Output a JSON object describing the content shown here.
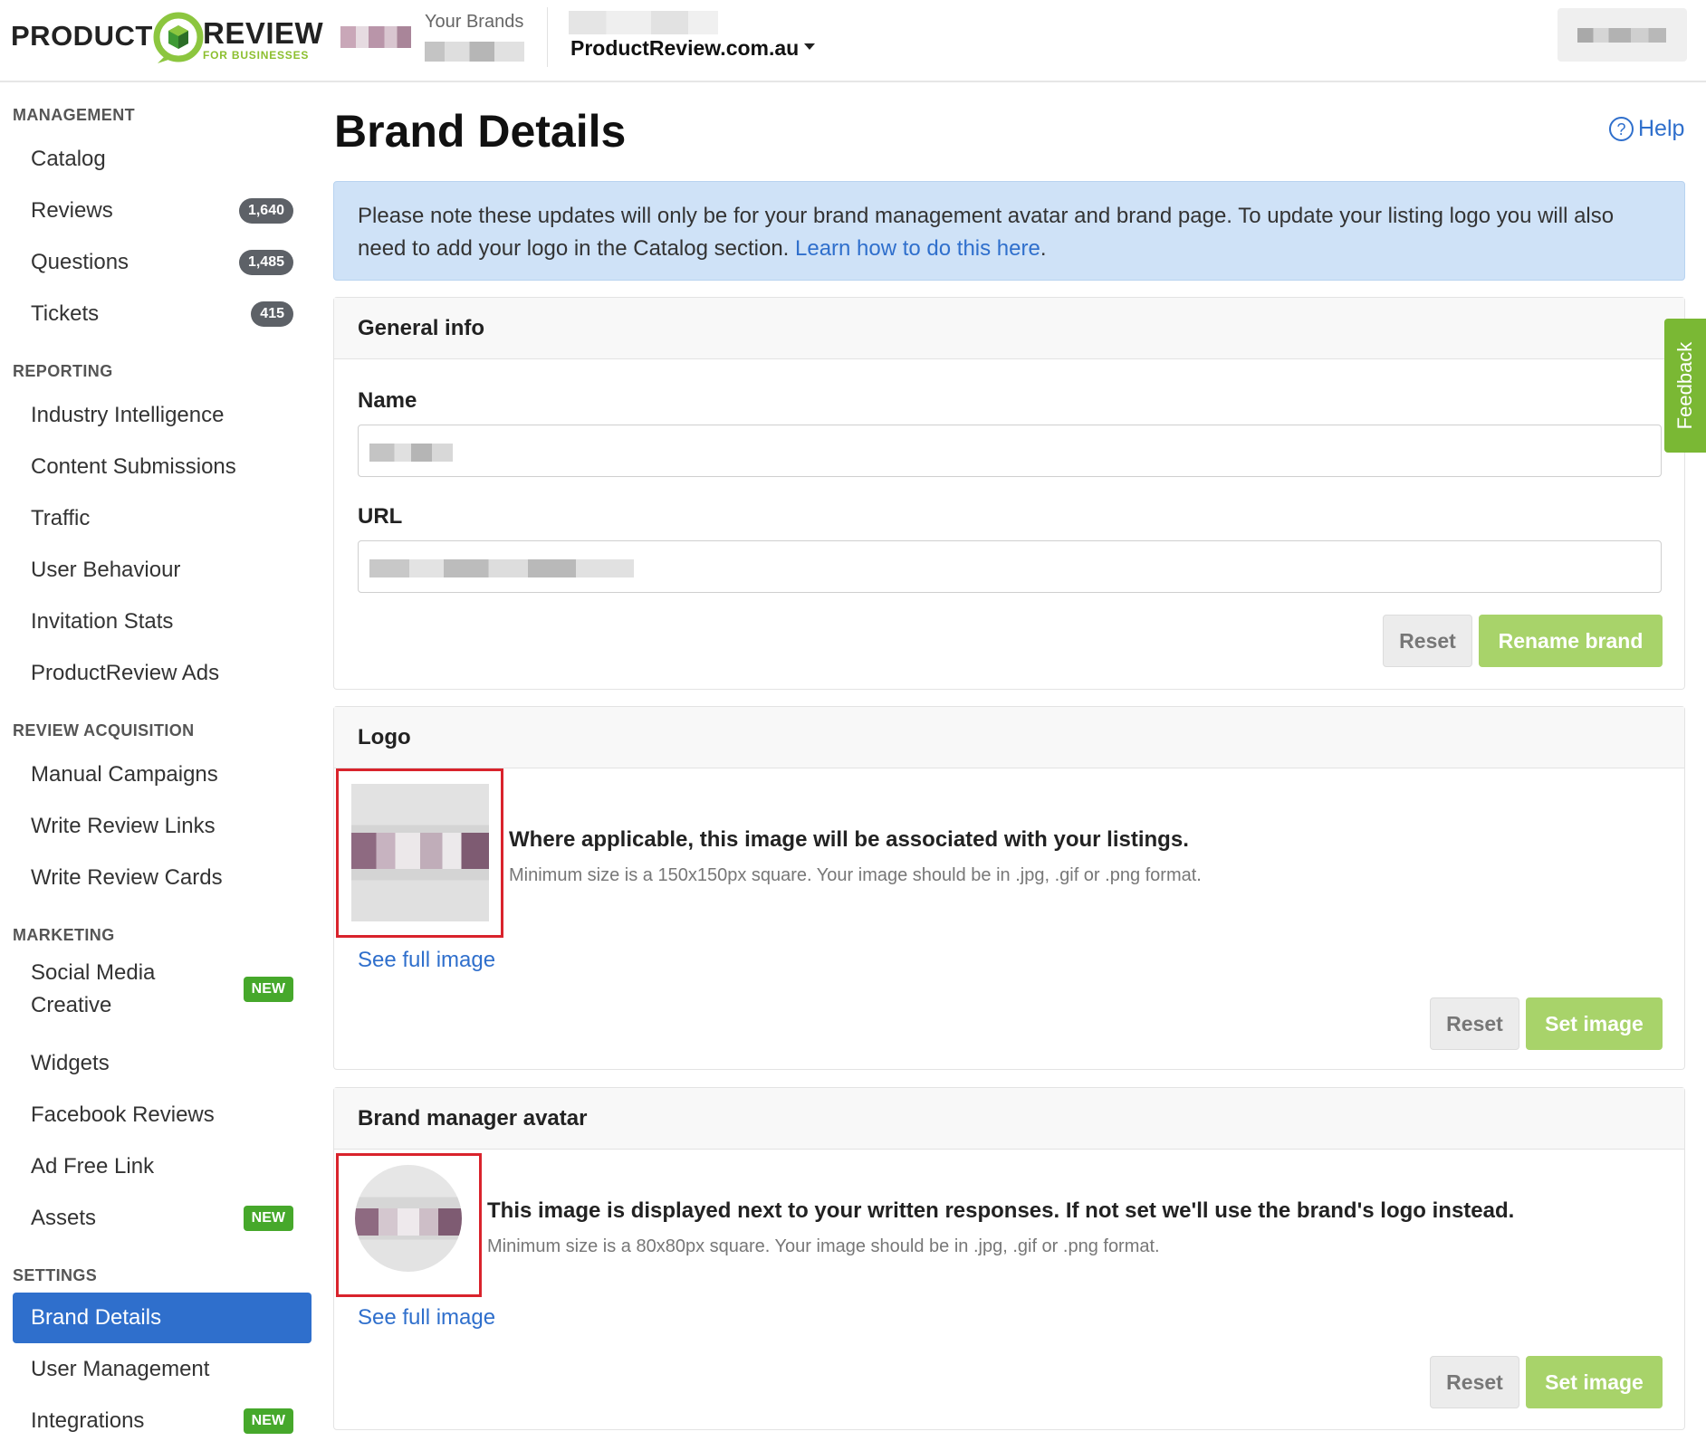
{
  "header": {
    "logo_left": "PRODUCT",
    "logo_right": "REVIEW",
    "logo_sub": "FOR BUSINESSES",
    "your_brands_label": "Your Brands",
    "account_site": "ProductReview.com.au"
  },
  "sidebar": {
    "sections": {
      "management": "MANAGEMENT",
      "reporting": "REPORTING",
      "review_acquisition": "REVIEW ACQUISITION",
      "marketing": "MARKETING",
      "settings": "SETTINGS"
    },
    "items": {
      "catalog": "Catalog",
      "reviews": "Reviews",
      "reviews_badge": "1,640",
      "questions": "Questions",
      "questions_badge": "1,485",
      "tickets": "Tickets",
      "tickets_badge": "415",
      "industry_intelligence": "Industry Intelligence",
      "content_submissions": "Content Submissions",
      "traffic": "Traffic",
      "user_behaviour": "User Behaviour",
      "invitation_stats": "Invitation Stats",
      "productreview_ads": "ProductReview Ads",
      "manual_campaigns": "Manual Campaigns",
      "write_review_links": "Write Review Links",
      "write_review_cards": "Write Review Cards",
      "social_media_creative_1": "Social Media",
      "social_media_creative_2": "Creative",
      "widgets": "Widgets",
      "facebook_reviews": "Facebook Reviews",
      "ad_free_link": "Ad Free Link",
      "assets": "Assets",
      "brand_details": "Brand Details",
      "user_management": "User Management",
      "integrations": "Integrations",
      "new_badge": "NEW"
    }
  },
  "main": {
    "title": "Brand Details",
    "help": "Help",
    "notice_text": "Please note these updates will only be for your brand management avatar and brand page. To update your listing logo you will also need to add your logo in the Catalog section. ",
    "notice_link": "Learn how to do this here",
    "notice_end": ".",
    "general_info": {
      "header": "General info",
      "name_label": "Name",
      "url_label": "URL",
      "reset": "Reset",
      "rename": "Rename brand"
    },
    "logo": {
      "header": "Logo",
      "desc": "Where applicable, this image will be associated with your listings.",
      "hint": "Minimum size is a 150x150px square. Your image should be in .jpg, .gif or .png format.",
      "see_full": "See full image",
      "reset": "Reset",
      "set": "Set image"
    },
    "avatar": {
      "header": "Brand manager avatar",
      "desc": "This image is displayed next to your written responses. If not set we'll use the brand's logo instead.",
      "hint": "Minimum size is a 80x80px square. Your image should be in .jpg, .gif or .png format.",
      "see_full": "See full image",
      "reset": "Reset",
      "set": "Set image"
    }
  },
  "feedback": "Feedback",
  "colors": {
    "primary": "#2f6fcc",
    "accent_green": "#a8d36a",
    "badge_green": "#46a82b",
    "highlight_red": "#d9232c"
  }
}
